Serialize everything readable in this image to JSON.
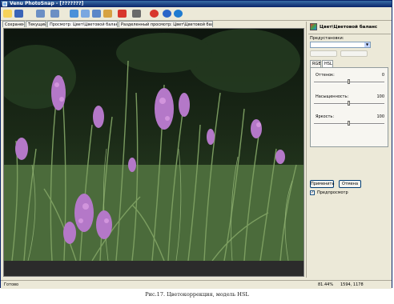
{
  "window": {
    "title": "Venu PhotoSnap - [???????]"
  },
  "toolbar": {
    "icons": [
      "open-icon",
      "save-icon",
      "undo-icon",
      "redo-icon",
      "brush-icon",
      "magic-wand-icon",
      "pipette-icon",
      "crop-icon",
      "arrow-icon",
      "stop-icon",
      "info-icon",
      "globe-icon"
    ]
  },
  "tabs": [
    {
      "label": "Сохранено"
    },
    {
      "label": "Текущий"
    },
    {
      "label": "Просмотр: Цвет\\Цветовой баланс"
    },
    {
      "label": "Разделенный просмотр: Цвет\\Цветовой баланс"
    }
  ],
  "panel": {
    "title": "Цвет\\Цветовой баланс",
    "presets_label": "Предустановки:",
    "preset_value": "",
    "preset_btn1": "",
    "preset_btn2": "",
    "mode_tabs": [
      "RGB",
      "HSL"
    ],
    "sliders": [
      {
        "label": "Оттенок:",
        "value": "0",
        "level": 0.5
      },
      {
        "label": "Насыщенность:",
        "value": "100",
        "level": 0.5
      },
      {
        "label": "Яркость:",
        "value": "100",
        "level": 0.5
      }
    ],
    "apply_label": "Применить",
    "cancel_label": "Отмена",
    "preview_label": "Предпросмотр",
    "preview_checked": true
  },
  "status": {
    "left": "Готово",
    "zoom": "81.44%",
    "dimensions": "1594, 1178"
  },
  "caption": "Рис.17. Цветокоррекция, модель HSL"
}
